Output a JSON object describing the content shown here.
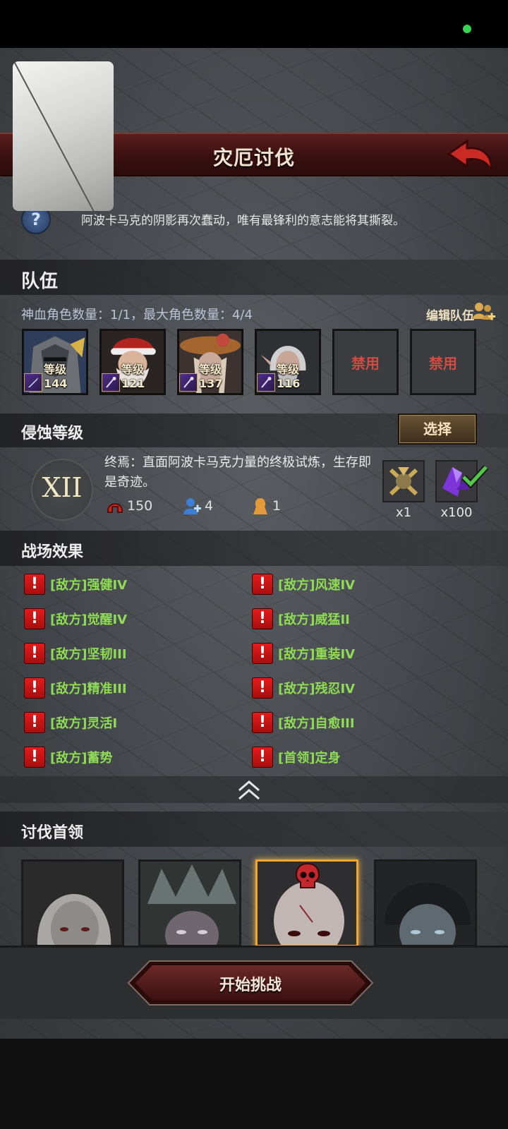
{
  "status": {
    "indicator_color": "#39d353"
  },
  "header": {
    "title": "灾厄讨伐",
    "back_icon": "red-arrow-back-icon"
  },
  "intro": {
    "text": "阿波卡马克的阴影再次蠢动，唯有最锋利的意志能将其撕裂。"
  },
  "team": {
    "section_title": "队伍",
    "info": "神血角色数量：1/1，最大角色数量：4/4",
    "edit_label": "编辑队伍",
    "heroes": [
      {
        "level": "等级144",
        "weapon": "sword-icon"
      },
      {
        "level": "等级121",
        "weapon": "staff-icon"
      },
      {
        "level": "等级137",
        "weapon": "staff-icon"
      },
      {
        "level": "等级116",
        "weapon": "staff-icon"
      }
    ],
    "locked": [
      "禁用",
      "禁用"
    ]
  },
  "corruption": {
    "section_title": "侵蚀等级",
    "select_label": "选择",
    "level_numeral": "XII",
    "description": "终焉：直面阿波卡马克力量的终极试炼，生存即是奇迹。",
    "stats": {
      "difficulty": "150",
      "players": "4",
      "revives": "1"
    },
    "rewards": [
      {
        "count": "x1"
      },
      {
        "count": "x100"
      }
    ]
  },
  "battlefield": {
    "section_title": "战场效果",
    "left": [
      "[敌方]强健IV",
      "[敌方]觉醒IV",
      "[敌方]坚韧III",
      "[敌方]精准III",
      "[敌方]灵活I",
      "[敌方]蓄势"
    ],
    "right": [
      "[敌方]风速IV",
      "[敌方]威猛II",
      "[敌方]重装IV",
      "[敌方]残忍IV",
      "[敌方]自愈III",
      "[首领]定身"
    ]
  },
  "bosses": {
    "section_title": "讨伐首领"
  },
  "footer": {
    "start_label": "开始挑战"
  }
}
